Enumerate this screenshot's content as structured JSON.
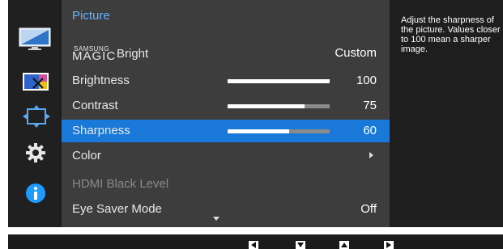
{
  "menu": {
    "title": "Picture",
    "items": [
      {
        "brand_small": "SAMSUNG",
        "brand_big": "MAGIC",
        "label": "Bright",
        "value": "Custom"
      },
      {
        "label": "Brightness",
        "value": "100",
        "slider": 1.0
      },
      {
        "label": "Contrast",
        "value": "75",
        "slider": 0.75
      },
      {
        "label": "Sharpness",
        "value": "60",
        "slider": 0.6,
        "selected": true
      },
      {
        "label": "Color",
        "submenu": true
      },
      {
        "label": "HDMI Black Level",
        "disabled": true
      },
      {
        "label": "Eye Saver Mode",
        "value": "Off"
      }
    ]
  },
  "help_text": "Adjust the sharpness of the picture. Values closer to 100 mean a sharper image.",
  "sidebar_icons": [
    "picture-icon",
    "color-icon",
    "size-position-icon",
    "settings-gear-icon",
    "info-icon"
  ],
  "nav_buttons": [
    "left-arrow-button",
    "down-arrow-button",
    "up-arrow-button",
    "right-arrow-button"
  ],
  "colors": {
    "accent": "#1a78d8",
    "title": "#66b3ff",
    "info": "#1e9bff"
  }
}
